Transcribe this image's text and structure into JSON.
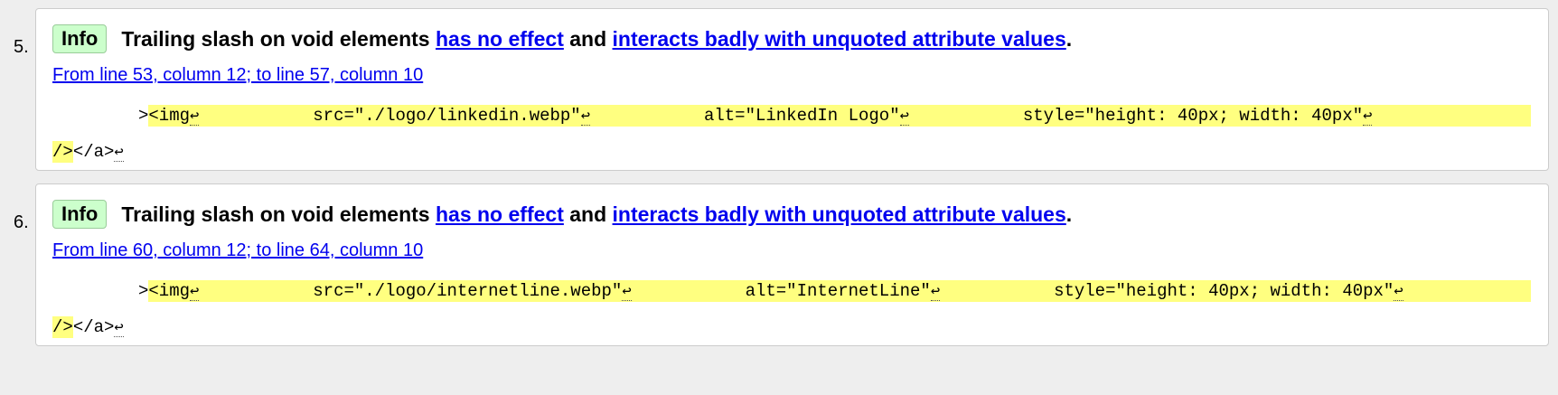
{
  "messages": [
    {
      "number": "5.",
      "badge": "Info",
      "text_1": "Trailing slash on void elements",
      "link_1": "has no effect",
      "text_2": "and",
      "link_2": "interacts badly with unquoted attribute values",
      "text_3": ".",
      "location": "From line 53, column 12; to line 57, column 10",
      "code": {
        "prefix": ">",
        "tag": "<img",
        "src": "src=\"./logo/linkedin.webp\"",
        "alt": "alt=\"LinkedIn Logo\"",
        "style": "style=\"height: 40px; width: 40px\"",
        "end_hl": "/>",
        "end_tail": "</a>"
      }
    },
    {
      "number": "6.",
      "badge": "Info",
      "text_1": "Trailing slash on void elements",
      "link_1": "has no effect",
      "text_2": "and",
      "link_2": "interacts badly with unquoted attribute values",
      "text_3": ".",
      "location": "From line 60, column 12; to line 64, column 10",
      "code": {
        "prefix": ">",
        "tag": "<img",
        "src": "src=\"./logo/internetline.webp\"",
        "alt": "alt=\"InternetLine\"",
        "style": "style=\"height: 40px; width: 40px\"",
        "end_hl": "/>",
        "end_tail": "</a>"
      }
    }
  ],
  "return_glyph": "↩",
  "colors": {
    "info_badge_bg": "#ccffcc",
    "highlight": "#ffff80",
    "link": "#0000ee",
    "page_bg": "#eeeeee"
  }
}
